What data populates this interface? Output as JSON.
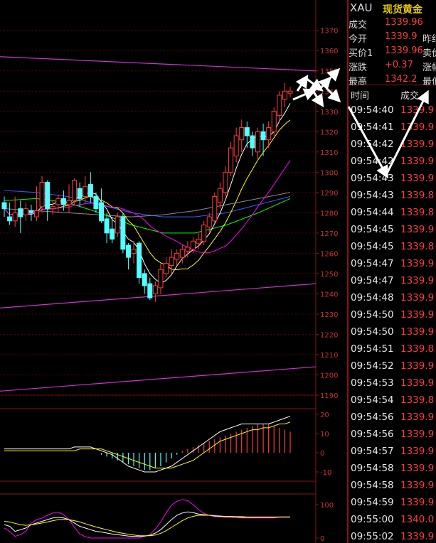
{
  "price_axis": {
    "labels": [
      "1370",
      "1360",
      "1350",
      "1340",
      "1330",
      "1320",
      "1310",
      "1300",
      "1290",
      "1280",
      "1270",
      "1260",
      "1250",
      "1240",
      "1230",
      "1220",
      "1210",
      "1200",
      "1190"
    ],
    "min": 1190,
    "max": 1372
  },
  "macd_axis": {
    "labels": [
      "20",
      "10",
      "0",
      "-10"
    ]
  },
  "kdj_axis": {
    "labels": [
      "100",
      "0"
    ]
  },
  "colors": {
    "up": "#ff3c3c",
    "down": "#54ffff",
    "grid": "#5a0000",
    "ma5": "#ffffff",
    "ma10": "#ffff00",
    "ma20": "#ff00ff",
    "ma60": "#00ff00",
    "ma120": "#3a5cff",
    "ma250": "#8c8c8c",
    "trend": "#cc33cc"
  },
  "quote": {
    "symbol": "XAU",
    "name": "现货黄金",
    "rows": [
      {
        "label": "成交",
        "value": "1339.96",
        "label2": ""
      },
      {
        "label": "今开",
        "value": "1339.9",
        "label2": "昨结"
      },
      {
        "label": "买价1",
        "value": "1339.96",
        "label2": "卖价"
      },
      {
        "label": "涨跌",
        "value": "+0.37",
        "label2": "涨幅"
      },
      {
        "label": "最高",
        "value": "1342.2",
        "label2": "最低"
      }
    ]
  },
  "ticks_header": {
    "time": "时间",
    "price": "成交"
  },
  "ticks": [
    {
      "time": "09:54:40",
      "price": "1339.9"
    },
    {
      "time": "09:54:41",
      "price": "1339.9"
    },
    {
      "time": "09:54:42",
      "price": "1339.9"
    },
    {
      "time": "09:54:42",
      "price": "1339.9"
    },
    {
      "time": "09:54:43",
      "price": "1339.9"
    },
    {
      "time": "09:54:43",
      "price": "1339.8"
    },
    {
      "time": "09:54:44",
      "price": "1339.8"
    },
    {
      "time": "09:54:45",
      "price": "1339.9"
    },
    {
      "time": "09:54:45",
      "price": "1339.8"
    },
    {
      "time": "09:54:47",
      "price": "1339.9"
    },
    {
      "time": "09:54:47",
      "price": "1339.9"
    },
    {
      "time": "09:54:48",
      "price": "1339.9"
    },
    {
      "time": "09:54:50",
      "price": "1339.9"
    },
    {
      "time": "09:54:50",
      "price": "1339.9"
    },
    {
      "time": "09:54:51",
      "price": "1339.8"
    },
    {
      "time": "09:54:52",
      "price": "1339.9"
    },
    {
      "time": "09:54:53",
      "price": "1339.9"
    },
    {
      "time": "09:54:54",
      "price": "1339.8"
    },
    {
      "time": "09:54:56",
      "price": "1339.9"
    },
    {
      "time": "09:54:56",
      "price": "1339.9"
    },
    {
      "time": "09:54:57",
      "price": "1339.9"
    },
    {
      "time": "09:54:58",
      "price": "1339.9"
    },
    {
      "time": "09:54:58",
      "price": "1339.9"
    },
    {
      "time": "09:54:59",
      "price": "1339.9"
    },
    {
      "time": "09:55:00",
      "price": "1340.0"
    },
    {
      "time": "09:55:02",
      "price": "1339.9"
    }
  ],
  "chart_data": {
    "type": "candlestick",
    "ylim": [
      1190,
      1372
    ],
    "candles": [
      {
        "o": 1285,
        "c": 1282,
        "h": 1288,
        "l": 1278
      },
      {
        "o": 1278,
        "c": 1276,
        "h": 1285,
        "l": 1274
      },
      {
        "o": 1276,
        "c": 1280,
        "h": 1288,
        "l": 1273
      },
      {
        "o": 1282,
        "c": 1278,
        "h": 1286,
        "l": 1270
      },
      {
        "o": 1279,
        "c": 1282,
        "h": 1285,
        "l": 1276
      },
      {
        "o": 1281,
        "c": 1280,
        "h": 1284,
        "l": 1276
      },
      {
        "o": 1278,
        "c": 1281,
        "h": 1293,
        "l": 1276
      },
      {
        "o": 1283,
        "c": 1295,
        "h": 1298,
        "l": 1280
      },
      {
        "o": 1295,
        "c": 1282,
        "h": 1296,
        "l": 1276
      },
      {
        "o": 1282,
        "c": 1283,
        "h": 1286,
        "l": 1279
      },
      {
        "o": 1284,
        "c": 1287,
        "h": 1289,
        "l": 1280
      },
      {
        "o": 1287,
        "c": 1284,
        "h": 1291,
        "l": 1281
      },
      {
        "o": 1284,
        "c": 1286,
        "h": 1294,
        "l": 1280
      },
      {
        "o": 1286,
        "c": 1296,
        "h": 1297,
        "l": 1284
      },
      {
        "o": 1292,
        "c": 1287,
        "h": 1295,
        "l": 1283
      },
      {
        "o": 1288,
        "c": 1293,
        "h": 1298,
        "l": 1285
      },
      {
        "o": 1294,
        "c": 1288,
        "h": 1300,
        "l": 1285
      },
      {
        "o": 1288,
        "c": 1282,
        "h": 1290,
        "l": 1280
      },
      {
        "o": 1285,
        "c": 1276,
        "h": 1292,
        "l": 1275
      },
      {
        "o": 1277,
        "c": 1270,
        "h": 1280,
        "l": 1265
      },
      {
        "o": 1272,
        "c": 1267,
        "h": 1278,
        "l": 1265
      },
      {
        "o": 1270,
        "c": 1278,
        "h": 1280,
        "l": 1268
      },
      {
        "o": 1278,
        "c": 1262,
        "h": 1280,
        "l": 1260
      },
      {
        "o": 1264,
        "c": 1258,
        "h": 1265,
        "l": 1252
      },
      {
        "o": 1260,
        "c": 1262,
        "h": 1266,
        "l": 1255
      },
      {
        "o": 1265,
        "c": 1248,
        "h": 1266,
        "l": 1245
      },
      {
        "o": 1250,
        "c": 1244,
        "h": 1252,
        "l": 1240
      },
      {
        "o": 1245,
        "c": 1238,
        "h": 1248,
        "l": 1237
      },
      {
        "o": 1240,
        "c": 1244,
        "h": 1246,
        "l": 1236
      },
      {
        "o": 1243,
        "c": 1252,
        "h": 1255,
        "l": 1240
      },
      {
        "o": 1250,
        "c": 1255,
        "h": 1258,
        "l": 1248
      },
      {
        "o": 1254,
        "c": 1258,
        "h": 1262,
        "l": 1250
      },
      {
        "o": 1257,
        "c": 1260,
        "h": 1262,
        "l": 1254
      },
      {
        "o": 1258,
        "c": 1262,
        "h": 1264,
        "l": 1255
      },
      {
        "o": 1261,
        "c": 1263,
        "h": 1266,
        "l": 1258
      },
      {
        "o": 1262,
        "c": 1266,
        "h": 1268,
        "l": 1260
      },
      {
        "o": 1265,
        "c": 1267,
        "h": 1270,
        "l": 1262
      },
      {
        "o": 1266,
        "c": 1274,
        "h": 1276,
        "l": 1264
      },
      {
        "o": 1273,
        "c": 1278,
        "h": 1280,
        "l": 1270
      },
      {
        "o": 1276,
        "c": 1288,
        "h": 1290,
        "l": 1275
      },
      {
        "o": 1285,
        "c": 1292,
        "h": 1295,
        "l": 1282
      },
      {
        "o": 1290,
        "c": 1300,
        "h": 1303,
        "l": 1288
      },
      {
        "o": 1300,
        "c": 1312,
        "h": 1315,
        "l": 1298
      },
      {
        "o": 1308,
        "c": 1318,
        "h": 1322,
        "l": 1305
      },
      {
        "o": 1316,
        "c": 1322,
        "h": 1326,
        "l": 1310
      },
      {
        "o": 1322,
        "c": 1318,
        "h": 1325,
        "l": 1312
      },
      {
        "o": 1318,
        "c": 1312,
        "h": 1320,
        "l": 1308
      },
      {
        "o": 1310,
        "c": 1320,
        "h": 1322,
        "l": 1306
      },
      {
        "o": 1320,
        "c": 1316,
        "h": 1324,
        "l": 1308
      },
      {
        "o": 1316,
        "c": 1322,
        "h": 1325,
        "l": 1312
      },
      {
        "o": 1320,
        "c": 1330,
        "h": 1332,
        "l": 1318
      },
      {
        "o": 1328,
        "c": 1338,
        "h": 1340,
        "l": 1325
      },
      {
        "o": 1336,
        "c": 1340,
        "h": 1344,
        "l": 1332
      },
      {
        "o": 1339,
        "c": 1340,
        "h": 1342,
        "l": 1337
      }
    ],
    "macd_hist": [
      0,
      0,
      0,
      0,
      0,
      0,
      0,
      0,
      0,
      0,
      0,
      0,
      0,
      0,
      0,
      0,
      0,
      0,
      -1,
      -2,
      -3,
      -4,
      -5,
      -6,
      -7,
      -8,
      -9,
      -9,
      -8,
      -7,
      -5,
      -3,
      -1,
      1,
      2,
      3,
      4,
      5,
      6,
      7,
      8,
      9,
      10,
      11,
      12,
      13,
      14,
      15,
      15,
      15,
      14,
      13,
      12,
      11
    ],
    "macd_dif": [
      2,
      2,
      2,
      2,
      2,
      2,
      2,
      2,
      2,
      2,
      2,
      2,
      2,
      3,
      3,
      3,
      3,
      2,
      1,
      0,
      -1,
      -3,
      -5,
      -7,
      -8,
      -9,
      -10,
      -10,
      -10,
      -9,
      -8,
      -7,
      -5,
      -3,
      -1,
      1,
      3,
      5,
      7,
      9,
      11,
      12,
      13,
      14,
      15,
      15,
      15,
      15,
      15,
      15,
      16,
      17,
      18,
      19
    ],
    "macd_dea": [
      1,
      1,
      1,
      1,
      1,
      1,
      1,
      1,
      1,
      1,
      1,
      1,
      1,
      1,
      2,
      2,
      2,
      2,
      2,
      1,
      0,
      -1,
      -2,
      -3,
      -4,
      -5,
      -6,
      -7,
      -8,
      -8,
      -8,
      -8,
      -7,
      -6,
      -5,
      -4,
      -2,
      0,
      2,
      4,
      6,
      7,
      8,
      9,
      10,
      11,
      12,
      12,
      13,
      13,
      14,
      15,
      15,
      16
    ],
    "kdj_k": [
      40,
      35,
      20,
      25,
      30,
      40,
      45,
      50,
      55,
      60,
      62,
      60,
      55,
      45,
      35,
      30,
      25,
      20,
      18,
      15,
      12,
      10,
      8,
      6,
      5,
      5,
      6,
      8,
      15,
      25,
      40,
      55,
      68,
      75,
      78,
      76,
      72,
      70,
      68,
      66,
      65,
      64,
      64,
      63,
      62,
      62,
      62,
      62,
      62,
      62,
      62,
      63,
      63,
      63
    ],
    "kdj_d": [
      50,
      48,
      44,
      40,
      38,
      40,
      42,
      45,
      48,
      52,
      55,
      56,
      55,
      52,
      48,
      43,
      38,
      33,
      29,
      25,
      21,
      17,
      14,
      11,
      9,
      7,
      7,
      7,
      9,
      14,
      22,
      32,
      42,
      52,
      60,
      65,
      68,
      68,
      68,
      67,
      66,
      65,
      65,
      64,
      64,
      63,
      63,
      63,
      63,
      63,
      63,
      63,
      63,
      63
    ],
    "kdj_j": [
      30,
      20,
      5,
      10,
      20,
      45,
      55,
      60,
      68,
      75,
      77,
      70,
      55,
      32,
      12,
      4,
      0,
      0,
      0,
      0,
      0,
      0,
      0,
      0,
      0,
      0,
      5,
      10,
      27,
      48,
      75,
      98,
      110,
      115,
      112,
      100,
      85,
      74,
      68,
      64,
      63,
      62,
      62,
      61,
      60,
      60,
      60,
      60,
      60,
      60,
      60,
      62,
      62,
      62
    ]
  }
}
